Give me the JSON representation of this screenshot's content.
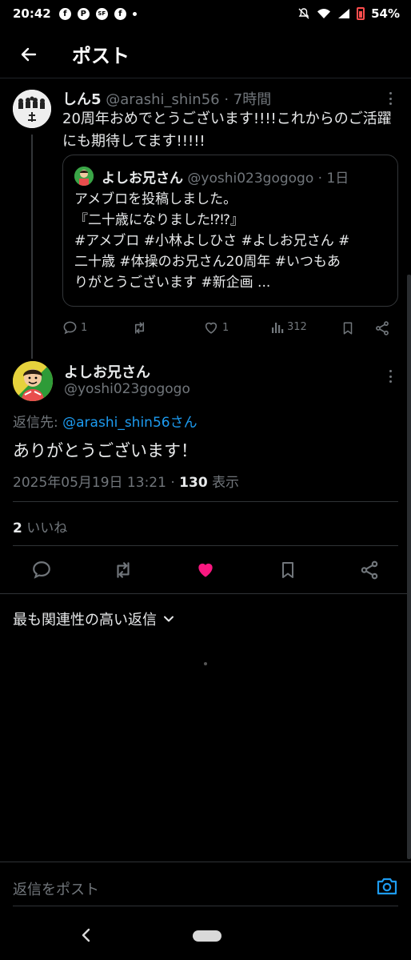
{
  "status_bar": {
    "time": "20:42",
    "battery": "54%",
    "notif_icons": [
      "f",
      "P",
      "SF",
      "f"
    ]
  },
  "header": {
    "title": "ポスト"
  },
  "reply_tweet": {
    "name": "しん5",
    "handle": "@arashi_shin56",
    "time": "7時間",
    "text": "20周年おめでとうございます!!!!これからのご活躍にも期待してます!!!!!",
    "actions": {
      "replies": "1",
      "likes": "1",
      "views": "312"
    }
  },
  "quoted_tweet": {
    "name": "よしお兄さん",
    "handle": "@yoshi023gogogo",
    "time": "1日",
    "line1": "アメブロを投稿しました。",
    "line2": "『二十歳になりました⁉⁉』",
    "line3": "#アメブロ #小林よしひさ #よしお兄さん #",
    "line4": "二十歳 #体操のお兄さん20周年 #いつもあ",
    "line5": "りがとうございます #新企画 ..."
  },
  "main_tweet": {
    "name": "よしお兄さん",
    "handle": "@yoshi023gogogo",
    "reply_prefix": "返信先: ",
    "reply_target": "@arashi_shin56さん",
    "text": "ありがとうございます！",
    "datetime": "2025年05月19日 13:21",
    "views_count": "130",
    "views_label": "表示",
    "likes_count": "2",
    "likes_label": "いいね"
  },
  "replies_sort": {
    "label": "最も関連性の高い返信"
  },
  "compose": {
    "placeholder": "返信をポスト"
  },
  "colors": {
    "accent": "#1d9bf0",
    "like": "#f91880",
    "muted": "#71767b"
  }
}
